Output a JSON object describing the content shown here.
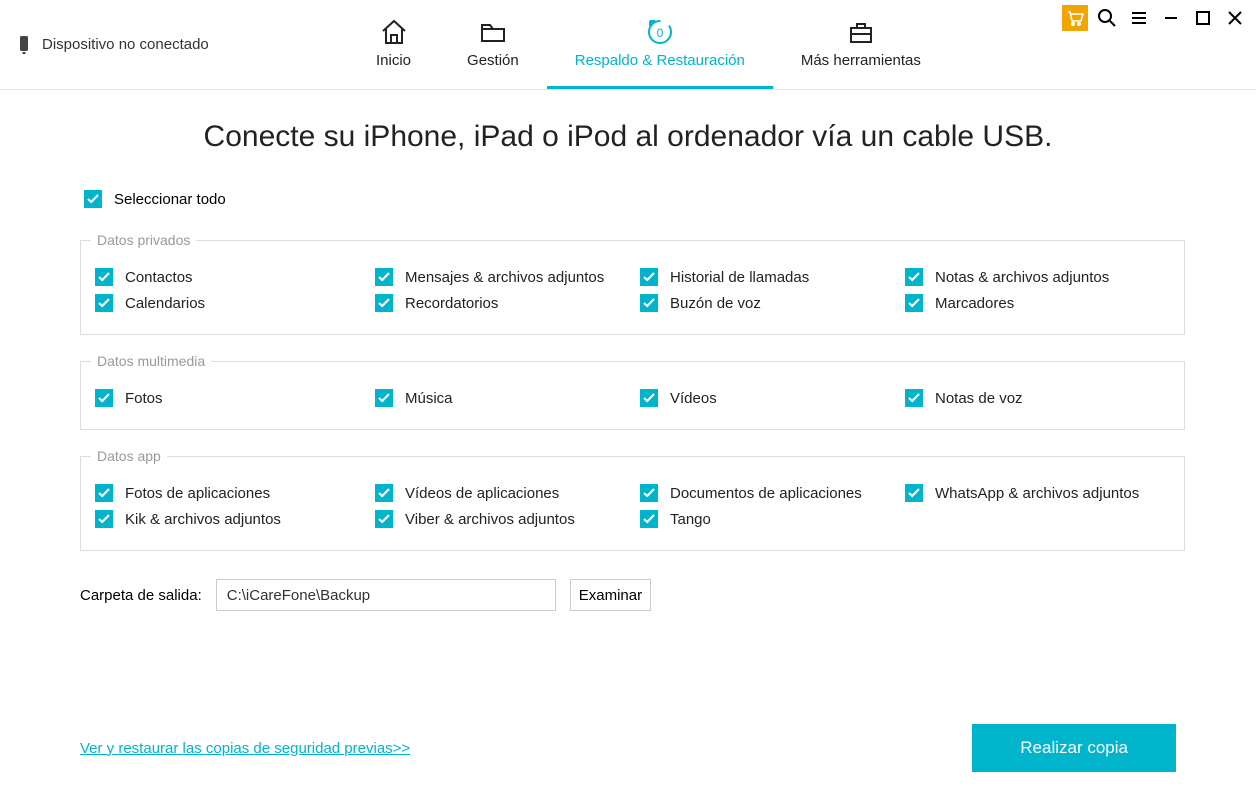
{
  "device_status": "Dispositivo no conectado",
  "tabs": {
    "home": "Inicio",
    "manage": "Gestión",
    "backup": "Respaldo & Restauración",
    "tools": "Más herramientas"
  },
  "headline": "Conecte su iPhone, iPad o iPod al ordenador vía un cable USB.",
  "select_all": "Seleccionar todo",
  "groups": {
    "private": {
      "legend": "Datos privados",
      "items": [
        "Contactos",
        "Mensajes & archivos adjuntos",
        "Historial de llamadas",
        "Notas & archivos adjuntos",
        "Calendarios",
        "Recordatorios",
        "Buzón de voz",
        "Marcadores"
      ]
    },
    "media": {
      "legend": "Datos multimedia",
      "items": [
        "Fotos",
        "Música",
        "Vídeos",
        "Notas de voz"
      ]
    },
    "app": {
      "legend": "Datos app",
      "items": [
        "Fotos de aplicaciones",
        "Vídeos de aplicaciones",
        "Documentos de aplicaciones",
        "WhatsApp & archivos adjuntos",
        "Kik & archivos adjuntos",
        "Viber & archivos adjuntos",
        "Tango"
      ]
    }
  },
  "output": {
    "label": "Carpeta de salida:",
    "path": "C:\\iCareFone\\Backup",
    "browse": "Examinar"
  },
  "restore_link": "Ver y restaurar las copias de seguridad previas>>",
  "primary_button": "Realizar copia"
}
